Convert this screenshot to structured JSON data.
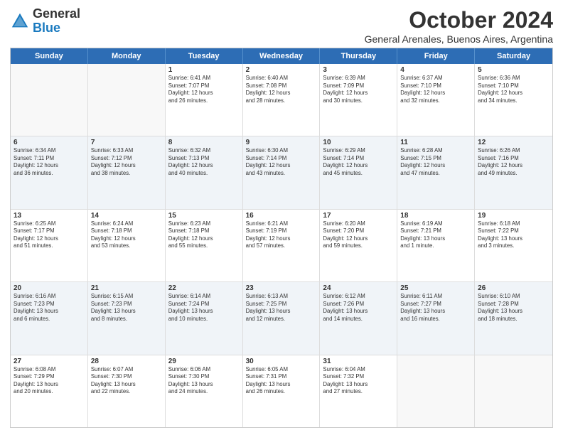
{
  "logo": {
    "general": "General",
    "blue": "Blue",
    "tagline": "GeneralBlue"
  },
  "title": "October 2024",
  "subtitle": "General Arenales, Buenos Aires, Argentina",
  "headers": [
    "Sunday",
    "Monday",
    "Tuesday",
    "Wednesday",
    "Thursday",
    "Friday",
    "Saturday"
  ],
  "weeks": [
    [
      {
        "day": "",
        "text": "",
        "empty": true
      },
      {
        "day": "",
        "text": "",
        "empty": true
      },
      {
        "day": "1",
        "text": "Sunrise: 6:41 AM\nSunset: 7:07 PM\nDaylight: 12 hours\nand 26 minutes."
      },
      {
        "day": "2",
        "text": "Sunrise: 6:40 AM\nSunset: 7:08 PM\nDaylight: 12 hours\nand 28 minutes."
      },
      {
        "day": "3",
        "text": "Sunrise: 6:39 AM\nSunset: 7:09 PM\nDaylight: 12 hours\nand 30 minutes."
      },
      {
        "day": "4",
        "text": "Sunrise: 6:37 AM\nSunset: 7:10 PM\nDaylight: 12 hours\nand 32 minutes."
      },
      {
        "day": "5",
        "text": "Sunrise: 6:36 AM\nSunset: 7:10 PM\nDaylight: 12 hours\nand 34 minutes."
      }
    ],
    [
      {
        "day": "6",
        "text": "Sunrise: 6:34 AM\nSunset: 7:11 PM\nDaylight: 12 hours\nand 36 minutes."
      },
      {
        "day": "7",
        "text": "Sunrise: 6:33 AM\nSunset: 7:12 PM\nDaylight: 12 hours\nand 38 minutes."
      },
      {
        "day": "8",
        "text": "Sunrise: 6:32 AM\nSunset: 7:13 PM\nDaylight: 12 hours\nand 40 minutes."
      },
      {
        "day": "9",
        "text": "Sunrise: 6:30 AM\nSunset: 7:14 PM\nDaylight: 12 hours\nand 43 minutes."
      },
      {
        "day": "10",
        "text": "Sunrise: 6:29 AM\nSunset: 7:14 PM\nDaylight: 12 hours\nand 45 minutes."
      },
      {
        "day": "11",
        "text": "Sunrise: 6:28 AM\nSunset: 7:15 PM\nDaylight: 12 hours\nand 47 minutes."
      },
      {
        "day": "12",
        "text": "Sunrise: 6:26 AM\nSunset: 7:16 PM\nDaylight: 12 hours\nand 49 minutes."
      }
    ],
    [
      {
        "day": "13",
        "text": "Sunrise: 6:25 AM\nSunset: 7:17 PM\nDaylight: 12 hours\nand 51 minutes."
      },
      {
        "day": "14",
        "text": "Sunrise: 6:24 AM\nSunset: 7:18 PM\nDaylight: 12 hours\nand 53 minutes."
      },
      {
        "day": "15",
        "text": "Sunrise: 6:23 AM\nSunset: 7:18 PM\nDaylight: 12 hours\nand 55 minutes."
      },
      {
        "day": "16",
        "text": "Sunrise: 6:21 AM\nSunset: 7:19 PM\nDaylight: 12 hours\nand 57 minutes."
      },
      {
        "day": "17",
        "text": "Sunrise: 6:20 AM\nSunset: 7:20 PM\nDaylight: 12 hours\nand 59 minutes."
      },
      {
        "day": "18",
        "text": "Sunrise: 6:19 AM\nSunset: 7:21 PM\nDaylight: 13 hours\nand 1 minute."
      },
      {
        "day": "19",
        "text": "Sunrise: 6:18 AM\nSunset: 7:22 PM\nDaylight: 13 hours\nand 3 minutes."
      }
    ],
    [
      {
        "day": "20",
        "text": "Sunrise: 6:16 AM\nSunset: 7:23 PM\nDaylight: 13 hours\nand 6 minutes."
      },
      {
        "day": "21",
        "text": "Sunrise: 6:15 AM\nSunset: 7:23 PM\nDaylight: 13 hours\nand 8 minutes."
      },
      {
        "day": "22",
        "text": "Sunrise: 6:14 AM\nSunset: 7:24 PM\nDaylight: 13 hours\nand 10 minutes."
      },
      {
        "day": "23",
        "text": "Sunrise: 6:13 AM\nSunset: 7:25 PM\nDaylight: 13 hours\nand 12 minutes."
      },
      {
        "day": "24",
        "text": "Sunrise: 6:12 AM\nSunset: 7:26 PM\nDaylight: 13 hours\nand 14 minutes."
      },
      {
        "day": "25",
        "text": "Sunrise: 6:11 AM\nSunset: 7:27 PM\nDaylight: 13 hours\nand 16 minutes."
      },
      {
        "day": "26",
        "text": "Sunrise: 6:10 AM\nSunset: 7:28 PM\nDaylight: 13 hours\nand 18 minutes."
      }
    ],
    [
      {
        "day": "27",
        "text": "Sunrise: 6:08 AM\nSunset: 7:29 PM\nDaylight: 13 hours\nand 20 minutes."
      },
      {
        "day": "28",
        "text": "Sunrise: 6:07 AM\nSunset: 7:30 PM\nDaylight: 13 hours\nand 22 minutes."
      },
      {
        "day": "29",
        "text": "Sunrise: 6:06 AM\nSunset: 7:30 PM\nDaylight: 13 hours\nand 24 minutes."
      },
      {
        "day": "30",
        "text": "Sunrise: 6:05 AM\nSunset: 7:31 PM\nDaylight: 13 hours\nand 26 minutes."
      },
      {
        "day": "31",
        "text": "Sunrise: 6:04 AM\nSunset: 7:32 PM\nDaylight: 13 hours\nand 27 minutes."
      },
      {
        "day": "",
        "text": "",
        "empty": true
      },
      {
        "day": "",
        "text": "",
        "empty": true
      }
    ]
  ]
}
